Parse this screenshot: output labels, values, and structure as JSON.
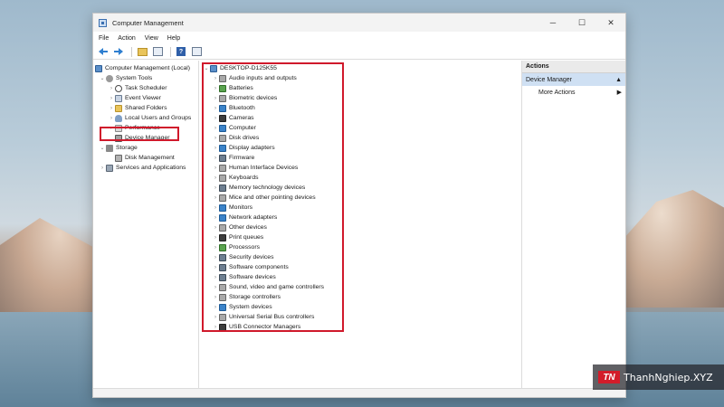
{
  "window": {
    "title": "Computer Management",
    "controls": [
      "─",
      "☐",
      "✕"
    ]
  },
  "menu": [
    "File",
    "Action",
    "View",
    "Help"
  ],
  "toolbar": {
    "buttons": [
      "back-arrow-icon",
      "forward-arrow-icon",
      "up-folder-icon",
      "show-hide-tree-icon",
      "help-icon",
      "properties-icon"
    ],
    "help_glyph": "?"
  },
  "left_tree": {
    "root": "Computer Management (Local)",
    "system_tools": "System Tools",
    "task_scheduler": "Task Scheduler",
    "event_viewer": "Event Viewer",
    "shared_folders": "Shared Folders",
    "local_users": "Local Users and Groups",
    "performance": "Performance",
    "device_manager": "Device Manager",
    "storage": "Storage",
    "disk_management": "Disk Management",
    "services": "Services and Applications"
  },
  "device_tree": {
    "computer_name": "DESKTOP-D125K55",
    "categories": [
      "Audio inputs and outputs",
      "Batteries",
      "Biometric devices",
      "Bluetooth",
      "Cameras",
      "Computer",
      "Disk drives",
      "Display adapters",
      "Firmware",
      "Human Interface Devices",
      "Keyboards",
      "Memory technology devices",
      "Mice and other pointing devices",
      "Monitors",
      "Network adapters",
      "Other devices",
      "Print queues",
      "Processors",
      "Security devices",
      "Software components",
      "Software devices",
      "Sound, video and game controllers",
      "Storage controllers",
      "System devices",
      "Universal Serial Bus controllers",
      "USB Connector Managers"
    ]
  },
  "actions_pane": {
    "header": "Actions",
    "section": "Device Manager",
    "more": "More Actions"
  },
  "watermark": {
    "logo": "TN",
    "text": "ThanhNghiep.XYZ"
  },
  "colors": {
    "highlight": "#d0192b",
    "selection": "#cfe0f3"
  }
}
